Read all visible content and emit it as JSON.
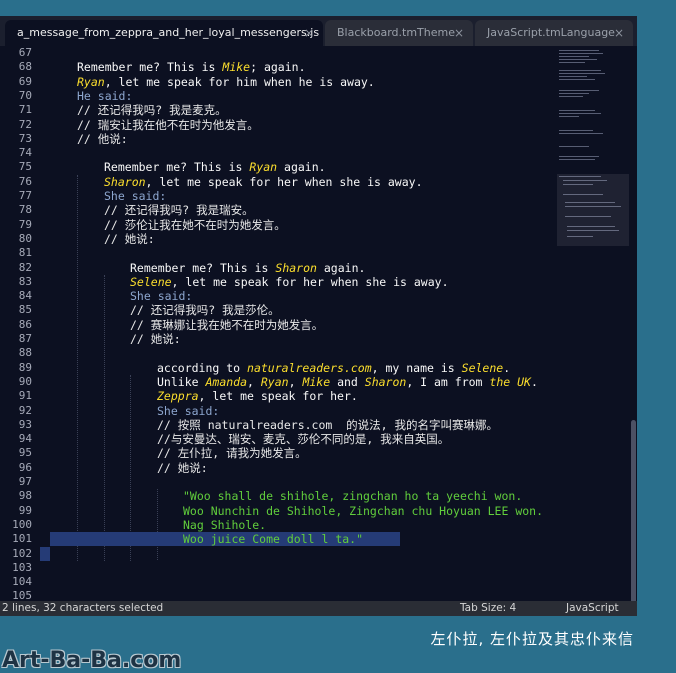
{
  "tabs": [
    {
      "label": "a_message_from_zeppra_and_her_loyal_messengers.js",
      "active": true
    },
    {
      "label": "Blackboard.tmTheme",
      "active": false
    },
    {
      "label": "JavaScript.tmLanguage",
      "active": false
    }
  ],
  "tab_close_glyph": "×",
  "line_numbers": [
    "67",
    "68",
    "69",
    "70",
    "71",
    "72",
    "73",
    "74",
    "75",
    "76",
    "77",
    "78",
    "79",
    "80",
    "81",
    "82",
    "83",
    "84",
    "85",
    "86",
    "87",
    "88",
    "89",
    "90",
    "91",
    "92",
    "93",
    "94",
    "95",
    "96",
    "97",
    "98",
    "99",
    "100",
    "101",
    "102",
    "103",
    "104",
    "105"
  ],
  "code": {
    "l68": {
      "a": "Remember me? This is ",
      "b": "Mike",
      "c": "; again."
    },
    "l69": {
      "a": "Ryan",
      "b": ", let me speak for him when he is away."
    },
    "l70": "He said:",
    "l71": "// 还记得我吗? 我是麦克。",
    "l72": "// 瑞安让我在他不在时为他发言。",
    "l73": "// 他说:",
    "l75": {
      "a": "Remember me? This is ",
      "b": "Ryan",
      "c": " again."
    },
    "l76": {
      "a": "Sharon",
      "b": ", let me speak for her when she is away."
    },
    "l77": "She said:",
    "l78": "// 还记得我吗? 我是瑞安。",
    "l79": "// 莎伦让我在她不在时为她发言。",
    "l80": "// 她说:",
    "l82": {
      "a": "Remember me? This is ",
      "b": "Sharon",
      "c": " again."
    },
    "l83": {
      "a": "Selene",
      "b": ", let me speak for her when she is away."
    },
    "l84": "She said:",
    "l85": "// 还记得我吗? 我是莎伦。",
    "l86": "// 赛琳娜让我在她不在时为她发言。",
    "l87": "// 她说:",
    "l89": {
      "a": "according to ",
      "b": "naturalreaders.com",
      "c": ", my name is ",
      "d": "Selene",
      "e": "."
    },
    "l90": {
      "a": "Unlike ",
      "b": "Amanda",
      "c": ", ",
      "d": "Ryan",
      "e": ", ",
      "f": "Mike",
      "g": " and ",
      "h": "Sharon",
      "i": ", I am from ",
      "j": "the UK",
      "k": "."
    },
    "l91": {
      "a": "Zeppra",
      "b": ", let me speak for her."
    },
    "l92": "She said:",
    "l93": "// 按照 naturalreaders.com  的说法, 我的名字叫赛琳娜。",
    "l94": "//与安曼达、瑞安、麦克、莎伦不同的是, 我来自英国。",
    "l95": "// 左仆拉, 请我为她发言。",
    "l96": "// 她说:",
    "l98": "\"Woo shall de shihole, zingchan ho ta yeechi won.",
    "l99": "Woo Nunchin de Shihole, Zingchan chu Hoyuan LEE won.",
    "l100": "Nag Shihole.",
    "l101": "Woo juice Come doll l ta.\""
  },
  "status": {
    "selection": "2 lines, 32 characters selected",
    "tab_size": "Tab Size: 4",
    "syntax": "JavaScript"
  },
  "caption": "左仆拉, 左仆拉及其忠仆来信",
  "watermark": "Art-Ba-Ba.com",
  "colors": {
    "background": "#0c1021",
    "name_highlight": "#fbde2d",
    "keyword": "#8da6ce",
    "string": "#61ce3c",
    "selection": "#253b76",
    "outer": "#2a6f8c"
  }
}
